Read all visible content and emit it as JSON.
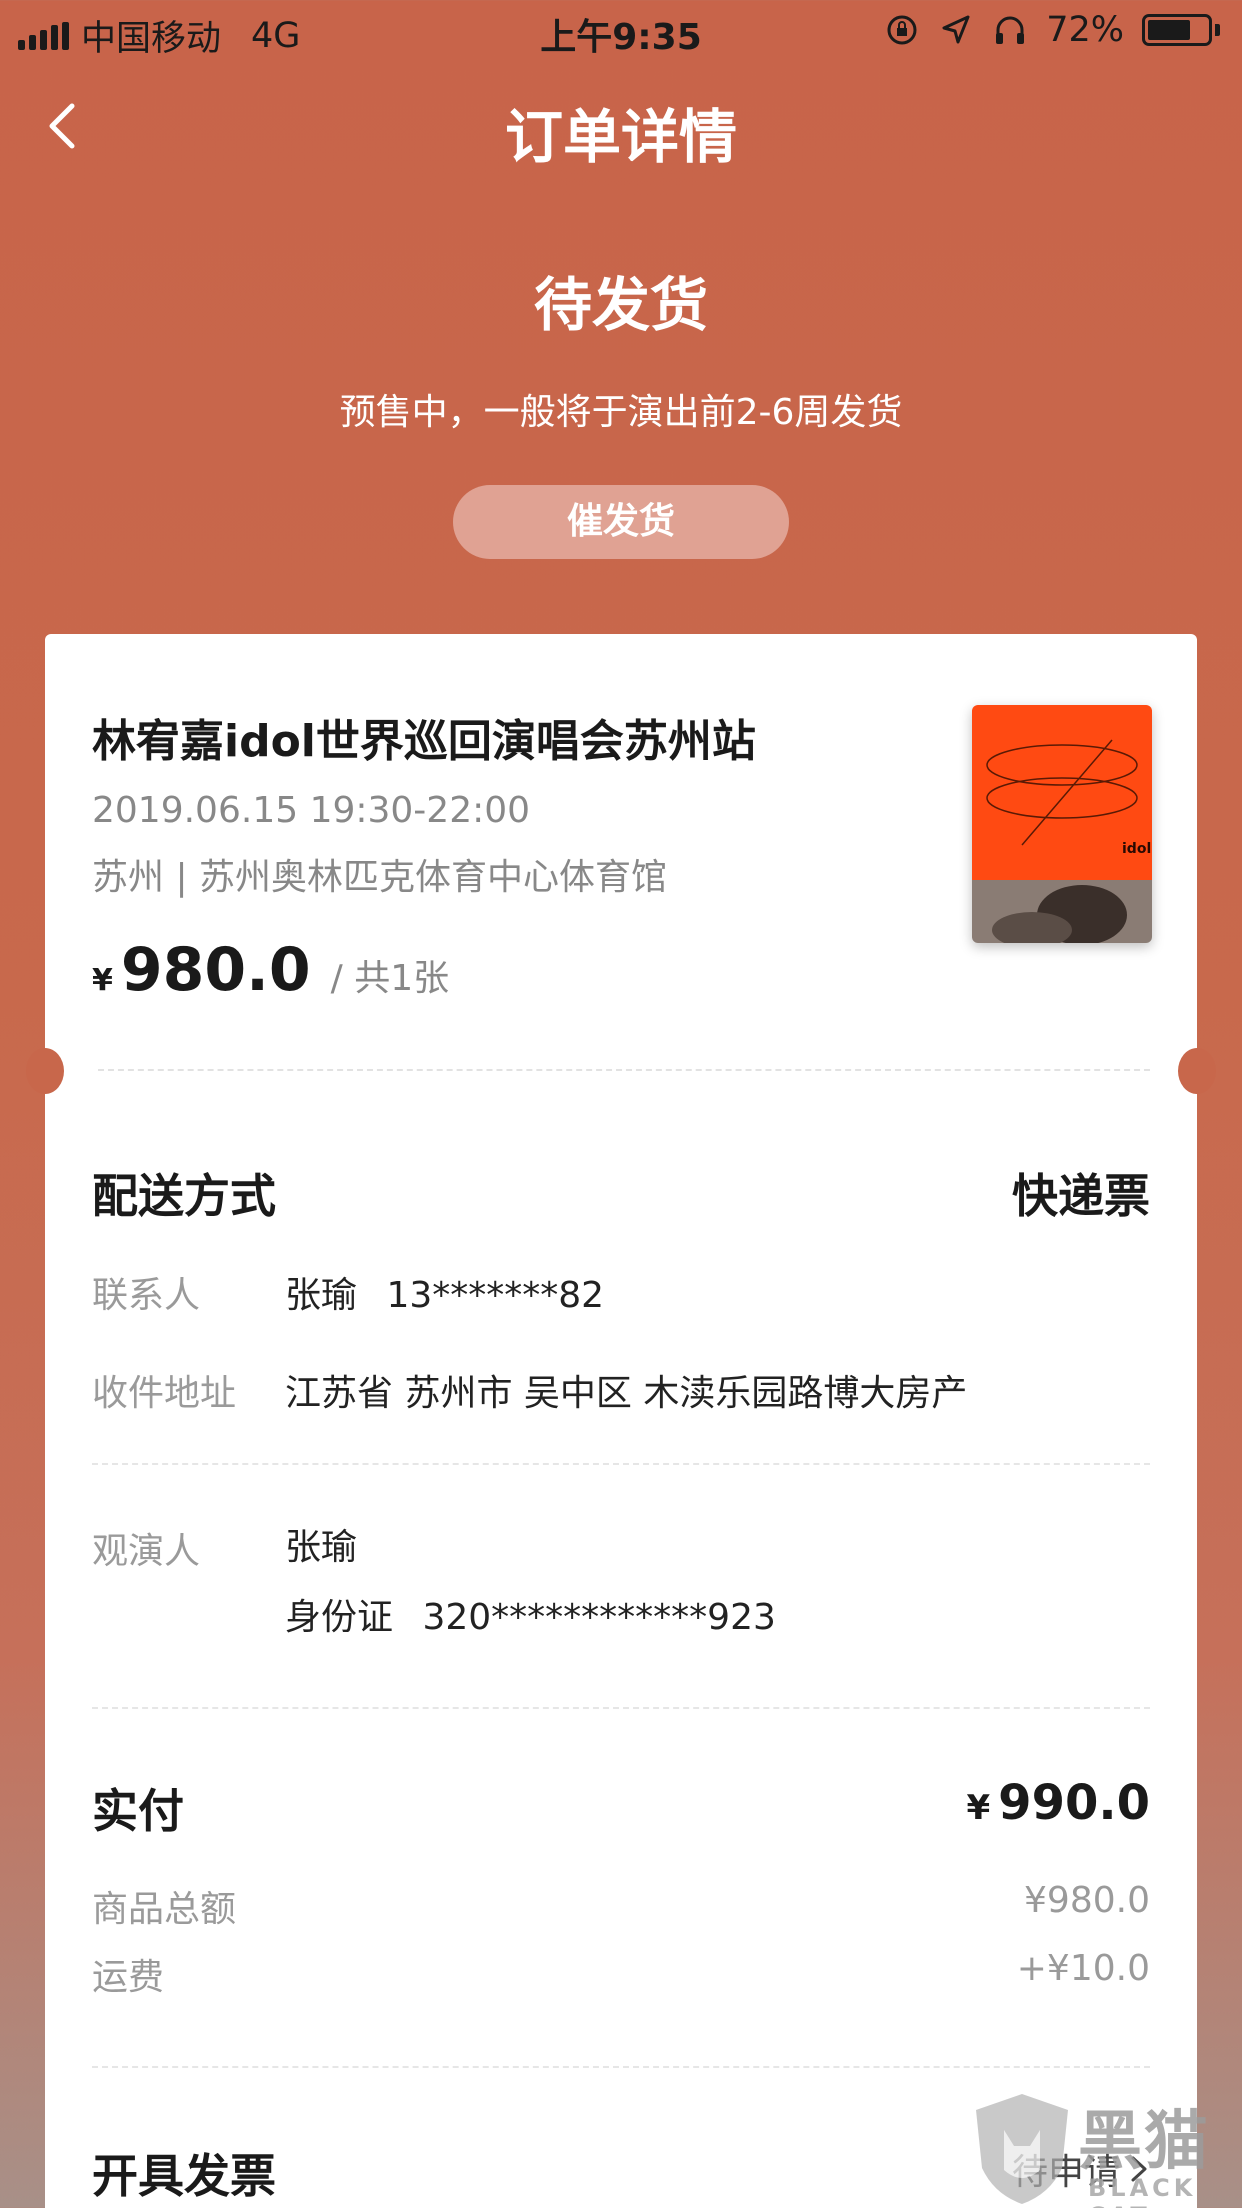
{
  "status_bar": {
    "carrier": "中国移动",
    "network": "4G",
    "time": "上午9:35",
    "battery_percent": "72%",
    "battery_level": 0.72
  },
  "nav": {
    "title": "订单详情"
  },
  "order": {
    "status": "待发货",
    "subtitle": "预售中，一般将于演出前2-6周发货",
    "urge_label": "催发货"
  },
  "event": {
    "title": "林宥嘉idol世界巡回演唱会苏州站",
    "time": "2019.06.15 19:30-22:00",
    "venue": "苏州 | 苏州奥林匹克体育中心体育馆",
    "currency": "¥",
    "price": "980.0",
    "quantity": "/ 共1张",
    "poster_text": "idol"
  },
  "delivery": {
    "title": "配送方式",
    "method": "快递票",
    "contact_label": "联系人",
    "contact_name": "张瑜",
    "contact_phone": "13*******82",
    "address_label": "收件地址",
    "address": "江苏省 苏州市 吴中区 木渎乐园路博大房产"
  },
  "viewer": {
    "label": "观演人",
    "name": "张瑜",
    "id_label": "身份证",
    "id_number": "320************923"
  },
  "payment": {
    "title": "实付",
    "currency": "¥",
    "total": "990.0",
    "subtotal_label": "商品总额",
    "subtotal": "¥980.0",
    "shipping_label": "运费",
    "shipping": "+¥10.0"
  },
  "invoice": {
    "title": "开具发票",
    "action": "待申请"
  },
  "watermark": {
    "text": "黑猫",
    "sub": "BLACK CAT"
  },
  "colors": {
    "header_bg": "#c8644a",
    "urge_button": "#e0a293",
    "poster_orange": "#ff4a12"
  }
}
